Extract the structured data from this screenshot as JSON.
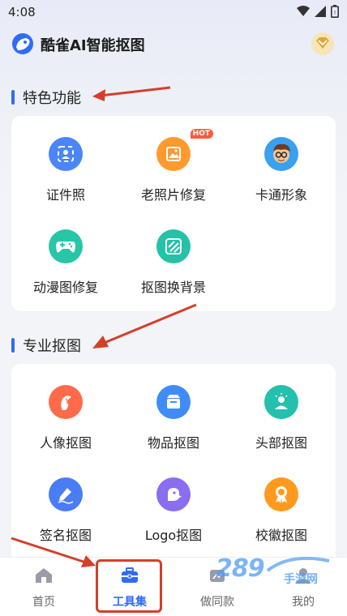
{
  "status": {
    "time": "4:08"
  },
  "header": {
    "title": "酷雀AI智能抠图"
  },
  "sections": [
    {
      "title": "特色功能",
      "items": [
        {
          "label": "证件照",
          "icon": "id-photo-icon",
          "color": "#4a86f7"
        },
        {
          "label": "老照片修复",
          "icon": "old-photo-icon",
          "color": "#ff9a2e",
          "badge": "HOT"
        },
        {
          "label": "卡通形象",
          "icon": "cartoon-avatar-icon",
          "color": "#3aa0f0"
        },
        {
          "label": "动漫图修复",
          "icon": "gamepad-icon",
          "color": "#27c6a6"
        },
        {
          "label": "抠图换背景",
          "icon": "background-swap-icon",
          "color": "#25c2a8"
        }
      ]
    },
    {
      "title": "专业抠图",
      "items": [
        {
          "label": "人像抠图",
          "icon": "portrait-icon",
          "color": "#ff6b4a"
        },
        {
          "label": "物品抠图",
          "icon": "box-icon",
          "color": "#3f8cf6"
        },
        {
          "label": "头部抠图",
          "icon": "head-icon",
          "color": "#22c0ad"
        },
        {
          "label": "签名抠图",
          "icon": "signature-icon",
          "color": "#4a7cf6"
        },
        {
          "label": "Logo抠图",
          "icon": "logo-icon",
          "color": "#8a6df0"
        },
        {
          "label": "校徽抠图",
          "icon": "badge-icon",
          "color": "#ff9a1e"
        }
      ]
    }
  ],
  "tabs": [
    {
      "label": "首页",
      "active": false
    },
    {
      "label": "工具集",
      "active": true
    },
    {
      "label": "做同款",
      "active": false
    },
    {
      "label": "我的",
      "active": false
    }
  ],
  "watermark": {
    "text": "289",
    "suffix": "手游网"
  },
  "colors": {
    "accent": "#2f6cf6",
    "annotation": "#d43f2a"
  }
}
